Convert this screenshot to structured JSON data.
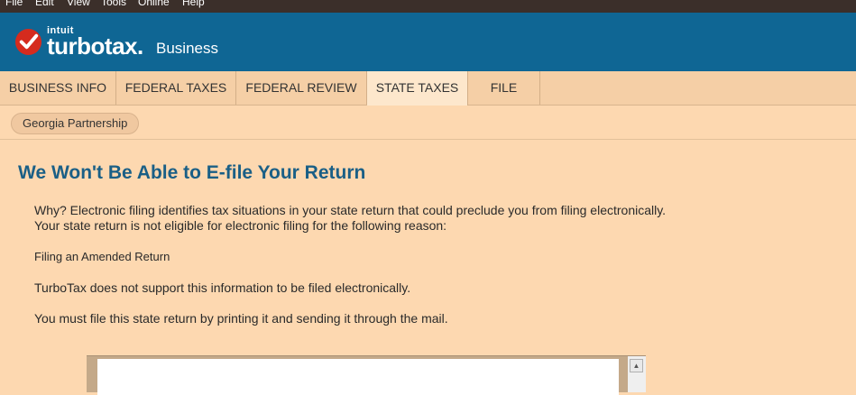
{
  "menu": [
    "File",
    "Edit",
    "View",
    "Tools",
    "Online",
    "Help"
  ],
  "brand": {
    "intuit": "intuit",
    "product": "turbotax.",
    "edition": "Business"
  },
  "tabs": [
    "BUSINESS INFO",
    "FEDERAL TAXES",
    "FEDERAL REVIEW",
    "STATE TAXES",
    "FILE"
  ],
  "active_tab": "STATE TAXES",
  "state_pill": "Georgia Partnership",
  "content": {
    "title": "We Won't Be Able to E-file Your Return",
    "why_line1": "Why? Electronic filing identifies tax situations in your state return that could preclude you from filing electronically.",
    "why_line2": "Your state return is not eligible for electronic filing for the following reason:",
    "reason": "Filing an Amended Return",
    "not_supported": "TurboTax does not support this information to be filed electronically.",
    "instruction": "You must file this state return by printing it and sending it through the mail."
  },
  "colors": {
    "header": "#0f6694",
    "background": "#fdd8b0",
    "title": "#1a5f86",
    "menubar": "#3b2f2a"
  }
}
